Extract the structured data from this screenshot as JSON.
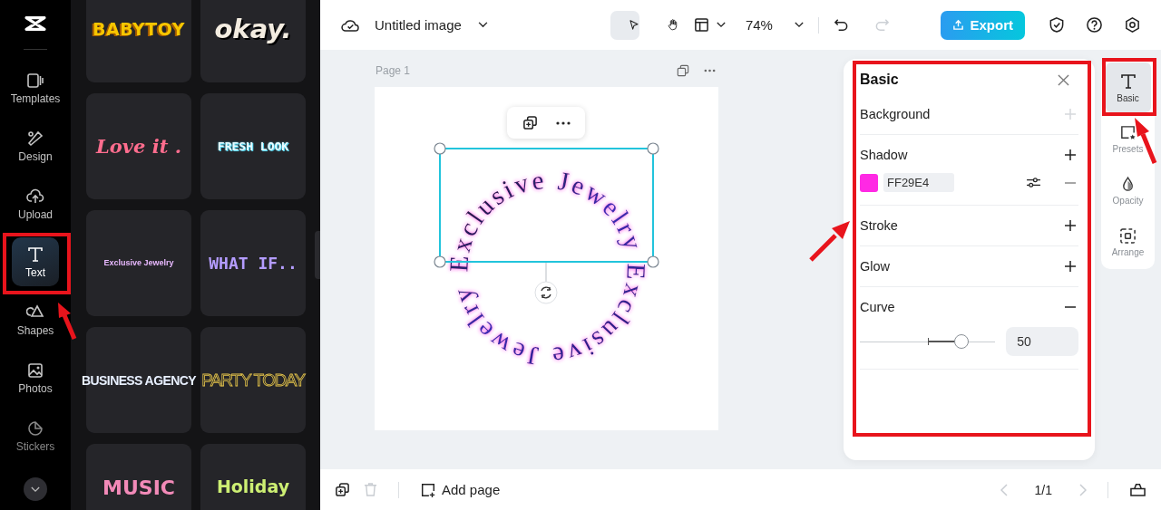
{
  "sidebar": {
    "items": [
      {
        "label": "Templates",
        "selected": false
      },
      {
        "label": "Design",
        "selected": false
      },
      {
        "label": "Upload",
        "selected": false
      },
      {
        "label": "Text",
        "selected": true
      },
      {
        "label": "Shapes",
        "selected": false
      },
      {
        "label": "Photos",
        "selected": false
      },
      {
        "label": "Stickers",
        "selected": false
      }
    ]
  },
  "text_presets": [
    "BABYTOY",
    "okay.",
    "Love it .",
    "FRESH LOOK",
    "Exclusive Jewelry",
    "WHAT IF..",
    "BUSINESS AGENCY",
    "PARTY TODAY",
    "MUSIC",
    "Holiday"
  ],
  "toolbar": {
    "title": "Untitled image",
    "zoom": "74%",
    "export": "Export",
    "tools": [
      {
        "selected": true
      },
      {
        "selected": false
      }
    ],
    "redo_disabled": true
  },
  "page": {
    "label": "Page 1",
    "curved_text": "Exclusive Jewelry Exclusive Jewelry"
  },
  "panel": {
    "title": "Basic",
    "sections": [
      {
        "kind": "plain",
        "label": "Background",
        "expanded": false,
        "disabled": true
      },
      {
        "kind": "shadow",
        "label": "Shadow",
        "expanded": false,
        "disabled": false,
        "color": "#ff29e4",
        "value": "FF29E4"
      },
      {
        "kind": "plain",
        "label": "Stroke",
        "expanded": false,
        "disabled": false
      },
      {
        "kind": "plain",
        "label": "Glow",
        "expanded": false,
        "disabled": false
      },
      {
        "kind": "curve",
        "label": "Curve",
        "expanded": true,
        "disabled": false,
        "level": 0.75,
        "value": "50"
      }
    ]
  },
  "rail": [
    {
      "label": "Basic",
      "selected": true
    },
    {
      "label": "Presets",
      "selected": false
    },
    {
      "label": "Opacity",
      "selected": false
    },
    {
      "label": "Arrange",
      "selected": false
    }
  ],
  "bottom_bar": {
    "add_page": "Add page",
    "pager": "1/1",
    "delete_disabled": true,
    "prev_disabled": true,
    "next_disabled": true
  }
}
